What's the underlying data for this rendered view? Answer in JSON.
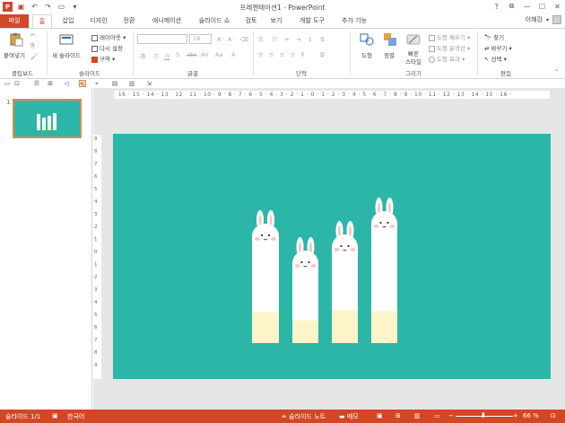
{
  "window": {
    "title": "프레젠테이션1 - PowerPoint",
    "help": "?",
    "restore": "⧉",
    "minimize": "—",
    "maximize": "☐",
    "close": "✕"
  },
  "user": {
    "name": "이해강"
  },
  "tabs": [
    {
      "label": "파일"
    },
    {
      "label": "홈"
    },
    {
      "label": "삽입"
    },
    {
      "label": "디자인"
    },
    {
      "label": "전환"
    },
    {
      "label": "애니메이션"
    },
    {
      "label": "슬라이드 쇼"
    },
    {
      "label": "검토"
    },
    {
      "label": "보기"
    },
    {
      "label": "개발 도구"
    },
    {
      "label": "추가 기능"
    }
  ],
  "ribbon": {
    "clipboard": {
      "paste": "붙여넣기",
      "label": "클립보드"
    },
    "slides": {
      "new_slide": "새 슬라이드",
      "layout": "레이아웃",
      "reset": "다시 설정",
      "section": "구역",
      "label": "슬라이드"
    },
    "font": {
      "font_size": "18",
      "label": "글꼴"
    },
    "paragraph": {
      "label": "단락"
    },
    "drawing": {
      "shape": "도형",
      "arrange": "정렬",
      "quick_styles": "빠른",
      "quick_styles2": "스타일",
      "fill": "도형 채우기",
      "outline": "도형 윤곽선",
      "effects": "도형 효과",
      "label": "그리기"
    },
    "editing": {
      "find": "찾기",
      "replace": "바꾸기",
      "select": "선택",
      "label": "편집"
    }
  },
  "ruler": {
    "horizontal": "· 16 · 15 · 14 · 13 · 12 · 11 · 10 · 9 · 8 · 7 · 6 · 5 · 4 · 3 · 2 · 1 · 0 · 1 · 2 · 3 · 4 · 5 · 6 · 7 · 8 · 9 · 10 · 11 · 12 · 13 · 14 · 15 · 16 ·",
    "vertical": [
      "9",
      "8",
      "7",
      "6",
      "5",
      "4",
      "3",
      "2",
      "1",
      "0",
      "1",
      "2",
      "3",
      "4",
      "5",
      "6",
      "7",
      "8",
      "9"
    ]
  },
  "slide_panel": {
    "slide_number": "1"
  },
  "slide": {
    "background": "#2cb6a8",
    "bar_fill_fractions": [
      0.28,
      0.27,
      0.33,
      0.26
    ]
  },
  "statusbar": {
    "slide_info": "슬라이드 1/1",
    "language": "한국어",
    "notes": "슬라이드 노트",
    "comments": "메모",
    "zoom": "66 %"
  }
}
